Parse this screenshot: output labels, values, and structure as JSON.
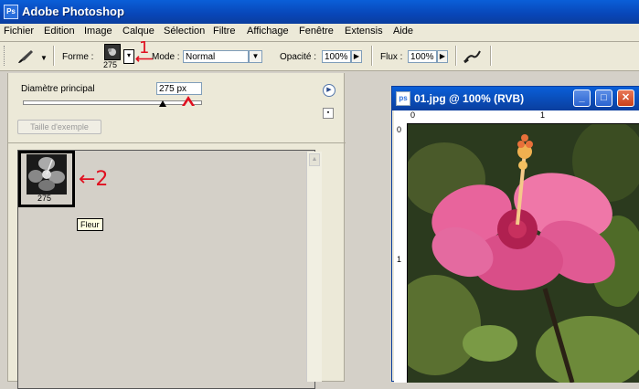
{
  "app": {
    "title": "Adobe Photoshop",
    "logo_text": "Ps"
  },
  "menu": [
    "Fichier",
    "Edition",
    "Image",
    "Calque",
    "Sélection",
    "Filtre",
    "Affichage",
    "Fenêtre",
    "Extensis",
    "Aide"
  ],
  "options": {
    "forme_label": "Forme :",
    "forme_size": "275",
    "mode_label": "Mode :",
    "mode_value": "Normal",
    "opacite_label": "Opacité :",
    "opacite_value": "100%",
    "flux_label": "Flux :",
    "flux_value": "100%"
  },
  "panel": {
    "diameter_label": "Diamètre principal",
    "diameter_value": "275 px",
    "sample_button": "Taille d'exemple",
    "preset_size": "275",
    "tooltip": "Fleur"
  },
  "annotations": {
    "one": "1",
    "two": "←2"
  },
  "doc": {
    "title": "01.jpg @ 100% (RVB)",
    "ruler_h": [
      "0",
      "1"
    ],
    "ruler_v": [
      "0",
      "1"
    ]
  },
  "colors": {
    "title_blue": "#0a5fd8",
    "annotation_red": "#e01020",
    "menu_bg": "#ece9d8"
  }
}
